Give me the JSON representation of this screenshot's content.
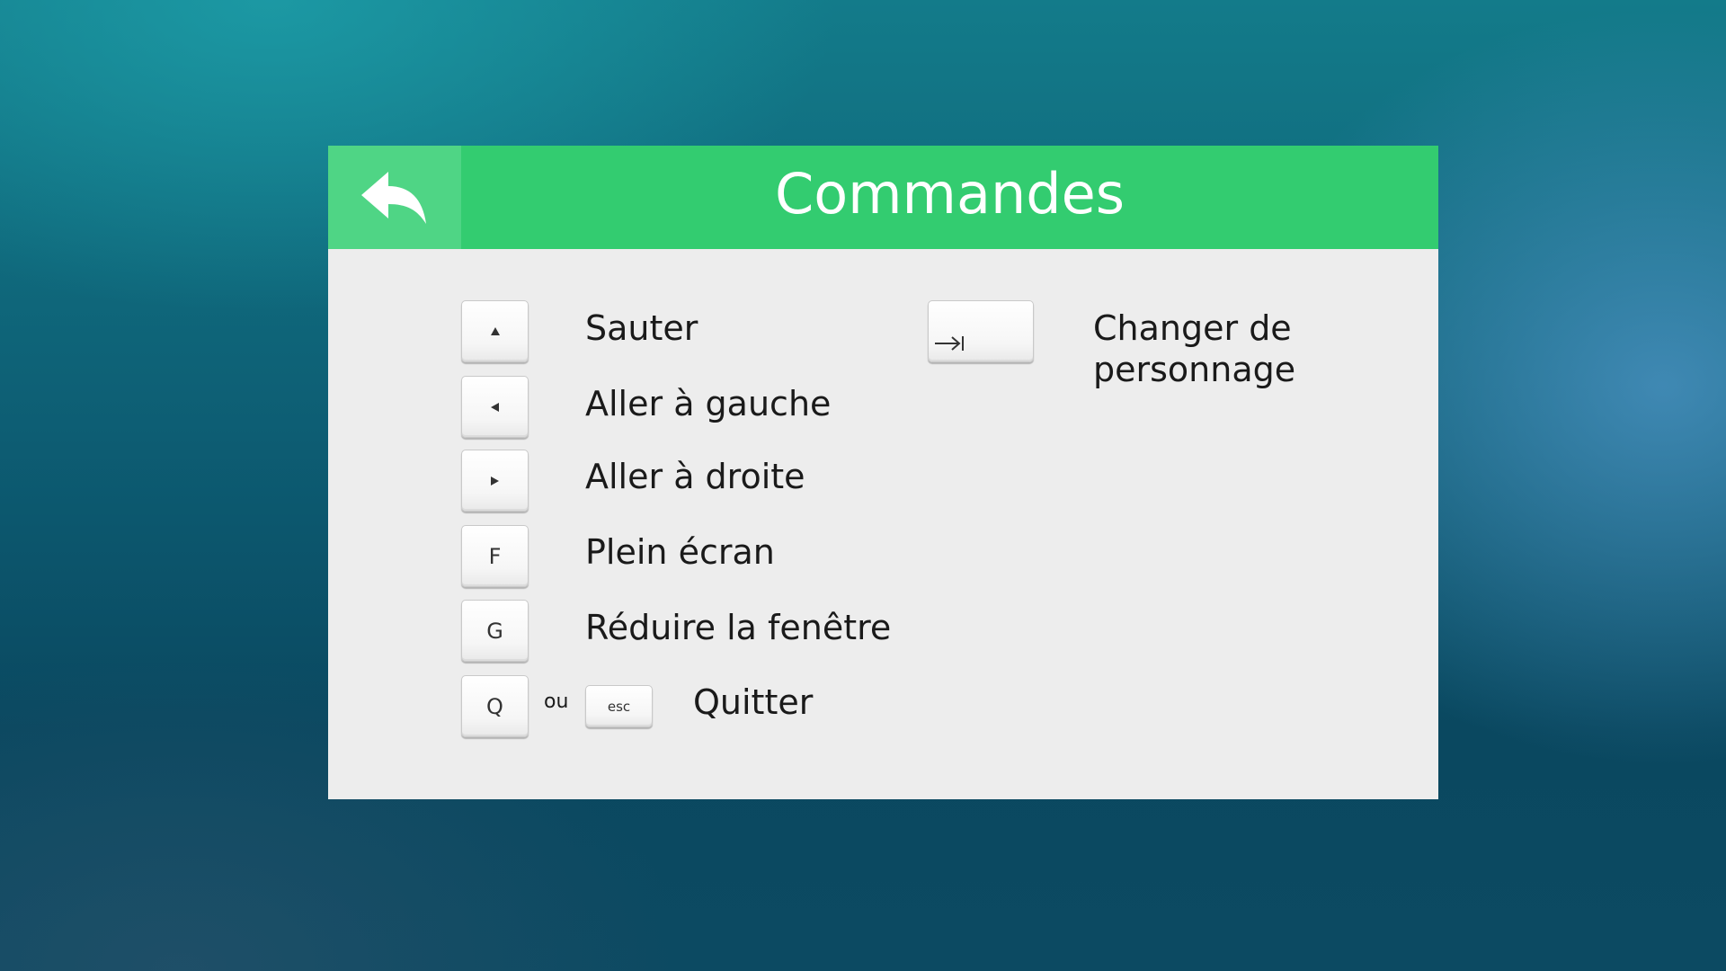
{
  "header": {
    "title": "Commandes",
    "back_icon": "back-arrow-icon",
    "accent_color": "#33cc70",
    "back_color": "#4fd585"
  },
  "commands": {
    "jump": {
      "key_icon": "triangle-up-icon",
      "label": "Sauter"
    },
    "left": {
      "key_icon": "triangle-left-icon",
      "label": "Aller à gauche"
    },
    "right": {
      "key_icon": "triangle-right-icon",
      "label": "Aller à droite"
    },
    "fullscreen": {
      "key": "F",
      "label": "Plein écran"
    },
    "minimize": {
      "key": "G",
      "label": "Réduire la fenêtre"
    },
    "quit": {
      "key": "Q",
      "or": "ou",
      "alt_key": "esc",
      "label": "Quitter"
    },
    "switch": {
      "key_icon": "tab-icon",
      "label": "Changer de personnage"
    }
  }
}
